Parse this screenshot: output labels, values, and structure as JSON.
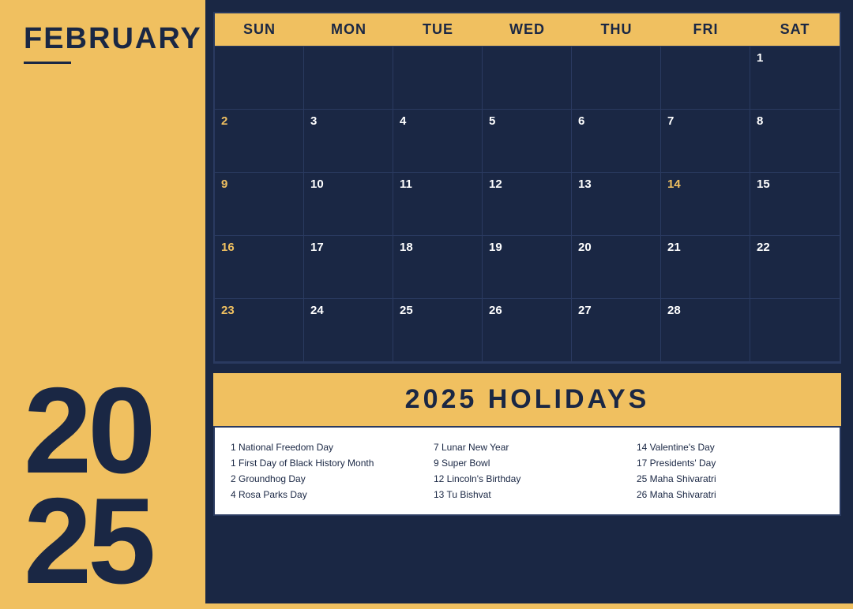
{
  "sidebar": {
    "month": "FEBRUARY",
    "year": "20\n25"
  },
  "calendar": {
    "headers": [
      "SUN",
      "MON",
      "TUE",
      "WED",
      "THU",
      "FRI",
      "SAT"
    ],
    "weeks": [
      [
        {
          "num": "",
          "gold": false
        },
        {
          "num": "",
          "gold": false
        },
        {
          "num": "",
          "gold": false
        },
        {
          "num": "",
          "gold": false
        },
        {
          "num": "",
          "gold": false
        },
        {
          "num": "",
          "gold": false
        },
        {
          "num": "1",
          "gold": false
        }
      ],
      [
        {
          "num": "2",
          "gold": true
        },
        {
          "num": "3",
          "gold": false
        },
        {
          "num": "4",
          "gold": false
        },
        {
          "num": "5",
          "gold": false
        },
        {
          "num": "6",
          "gold": false
        },
        {
          "num": "7",
          "gold": false
        },
        {
          "num": "8",
          "gold": false
        }
      ],
      [
        {
          "num": "9",
          "gold": true
        },
        {
          "num": "10",
          "gold": false
        },
        {
          "num": "11",
          "gold": false
        },
        {
          "num": "12",
          "gold": false
        },
        {
          "num": "13",
          "gold": false
        },
        {
          "num": "14",
          "gold": true
        },
        {
          "num": "15",
          "gold": false
        }
      ],
      [
        {
          "num": "16",
          "gold": true
        },
        {
          "num": "17",
          "gold": false
        },
        {
          "num": "18",
          "gold": false
        },
        {
          "num": "19",
          "gold": false
        },
        {
          "num": "20",
          "gold": false
        },
        {
          "num": "21",
          "gold": false
        },
        {
          "num": "22",
          "gold": false
        }
      ],
      [
        {
          "num": "23",
          "gold": true
        },
        {
          "num": "24",
          "gold": false
        },
        {
          "num": "25",
          "gold": false
        },
        {
          "num": "26",
          "gold": false
        },
        {
          "num": "27",
          "gold": false
        },
        {
          "num": "28",
          "gold": false
        },
        {
          "num": "",
          "gold": false
        }
      ]
    ]
  },
  "holidays": {
    "title": "2025 HOLIDAYS",
    "col1": [
      "1 National Freedom Day",
      "1 First Day of Black History Month",
      "2 Groundhog Day",
      "4 Rosa Parks Day"
    ],
    "col2": [
      "7 Lunar New Year",
      "9 Super Bowl",
      "12 Lincoln's Birthday",
      "13 Tu Bishvat"
    ],
    "col3": [
      "14 Valentine's Day",
      "17 Presidents' Day",
      "25 Maha Shivaratri",
      "26 Maha Shivaratri"
    ]
  }
}
